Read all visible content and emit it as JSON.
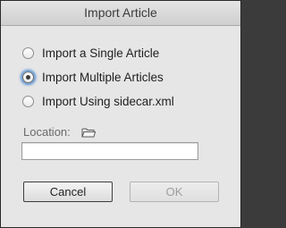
{
  "dialog": {
    "title": "Import Article",
    "options": [
      {
        "label": "Import a Single Article",
        "selected": false
      },
      {
        "label": "Import Multiple Articles",
        "selected": true
      },
      {
        "label": "Import Using sidecar.xml",
        "selected": false
      }
    ],
    "location": {
      "label": "Location:",
      "icon": "folder-icon",
      "value": "",
      "placeholder": ""
    },
    "buttons": {
      "cancel": "Cancel",
      "ok": "OK"
    }
  },
  "colors": {
    "dialog_bg": "#e6e6e6",
    "focus_ring": "#7fa9d9",
    "disabled_text": "#9d9d9d"
  }
}
